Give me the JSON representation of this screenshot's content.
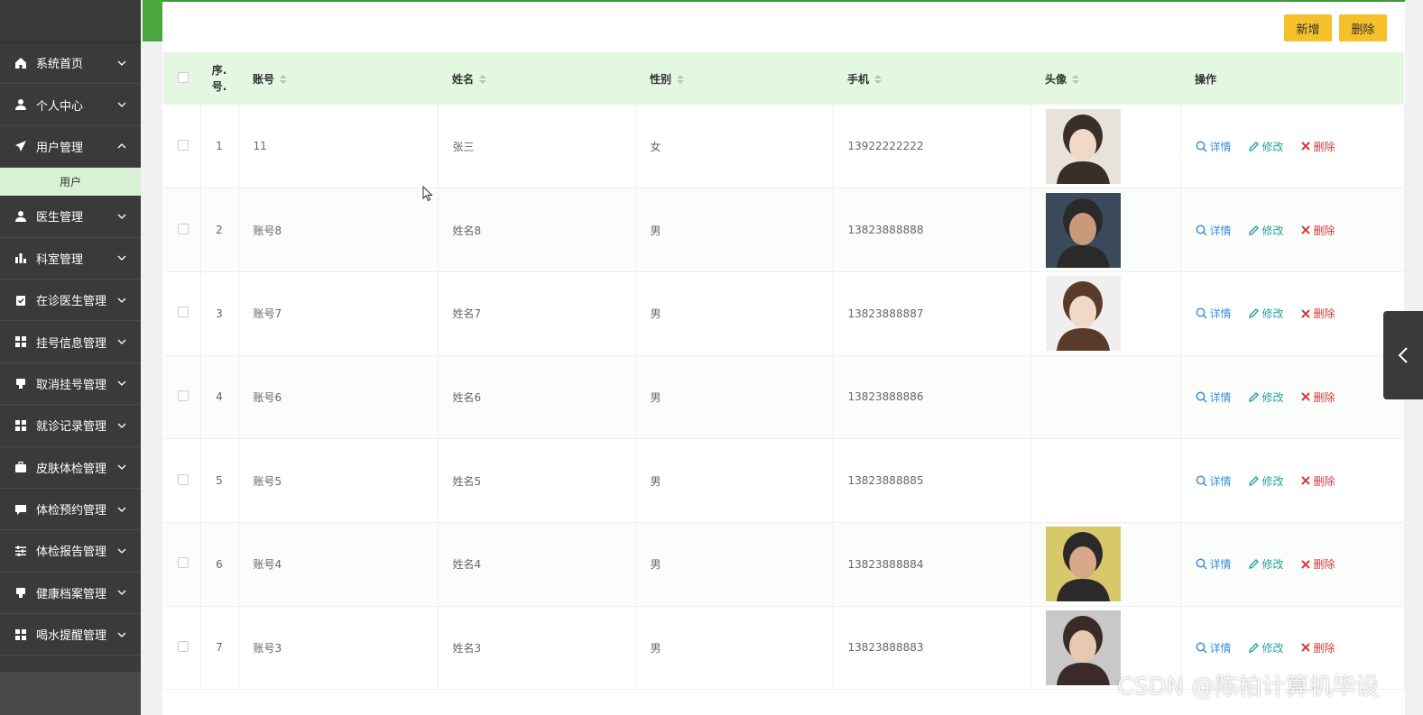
{
  "sidebar": {
    "items": [
      {
        "label": "系统首页",
        "icon": "home-icon"
      },
      {
        "label": "个人中心",
        "icon": "user-icon"
      },
      {
        "label": "用户管理",
        "icon": "send-icon",
        "expanded": true
      },
      {
        "label": "医生管理",
        "icon": "user-icon"
      },
      {
        "label": "科室管理",
        "icon": "bar-chart-icon"
      },
      {
        "label": "在诊医生管理",
        "icon": "clipboard-icon"
      },
      {
        "label": "挂号信息管理",
        "icon": "grid-icon"
      },
      {
        "label": "取消挂号管理",
        "icon": "stamp-icon"
      },
      {
        "label": "就诊记录管理",
        "icon": "grid-icon"
      },
      {
        "label": "皮肤体检管理",
        "icon": "briefcase-icon"
      },
      {
        "label": "体检预约管理",
        "icon": "chat-icon"
      },
      {
        "label": "体检报告管理",
        "icon": "sliders-icon"
      },
      {
        "label": "健康档案管理",
        "icon": "stamp-icon"
      },
      {
        "label": "喝水提醒管理",
        "icon": "grid-icon"
      }
    ],
    "subitem": "用户"
  },
  "toolbar": {
    "add_label": "新增",
    "delete_label": "删除"
  },
  "table": {
    "headers": {
      "index": "序.\n号.",
      "account": "账号",
      "name": "姓名",
      "gender": "性别",
      "phone": "手机",
      "avatar": "头像",
      "actions": "操作"
    },
    "actions": {
      "detail": "详情",
      "edit": "修改",
      "delete": "删除"
    },
    "rows": [
      {
        "index": "1",
        "account": "11",
        "name": "张三",
        "gender": "女",
        "phone": "13922222222",
        "avatar": "shown"
      },
      {
        "index": "2",
        "account": "账号8",
        "name": "姓名8",
        "gender": "男",
        "phone": "13823888888",
        "avatar": "shown"
      },
      {
        "index": "3",
        "account": "账号7",
        "name": "姓名7",
        "gender": "男",
        "phone": "13823888887",
        "avatar": "shown"
      },
      {
        "index": "4",
        "account": "账号6",
        "name": "姓名6",
        "gender": "男",
        "phone": "13823888886",
        "avatar": "empty"
      },
      {
        "index": "5",
        "account": "账号5",
        "name": "姓名5",
        "gender": "男",
        "phone": "13823888885",
        "avatar": "empty"
      },
      {
        "index": "6",
        "account": "账号4",
        "name": "姓名4",
        "gender": "男",
        "phone": "13823888884",
        "avatar": "shown"
      },
      {
        "index": "7",
        "account": "账号3",
        "name": "姓名3",
        "gender": "男",
        "phone": "13823888883",
        "avatar": "shown"
      }
    ]
  },
  "watermark": "CSDN @陈柏计算机毕设",
  "colors": {
    "sidebar": "#3a3a3a",
    "accent_green": "#4aa83e",
    "header_bg": "#e3f7e1",
    "button": "#f5c02a",
    "detail": "#3a8fd6",
    "edit": "#2aa0a0",
    "delete": "#d63a3a"
  }
}
